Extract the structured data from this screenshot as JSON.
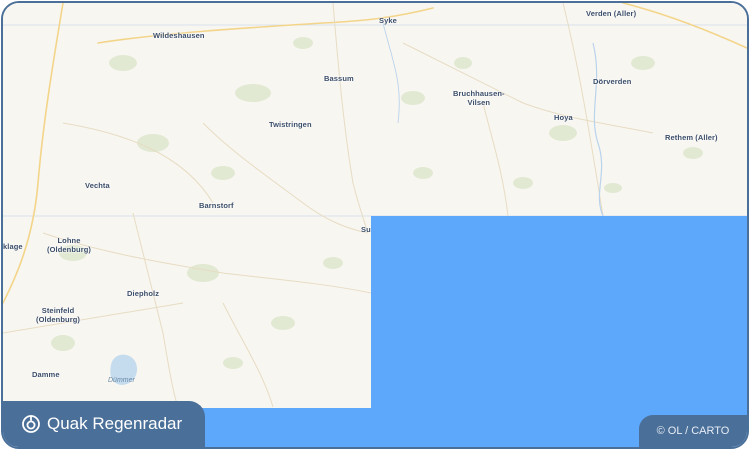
{
  "brand": {
    "name": "Quak Regenradar",
    "icon": "radar-icon"
  },
  "attribution": {
    "text": "© OL / CARTO"
  },
  "colors": {
    "frame": "#4a6f98",
    "radar_overlay": "#5ea8fb",
    "map_background": "#f8f6f1"
  },
  "map": {
    "places": {
      "wildeshausen": "Wildeshausen",
      "syke": "Syke",
      "verden": "Verden (Aller)",
      "bassum": "Bassum",
      "bruchhausen_1": "Bruchhausen-",
      "bruchhausen_2": "Vilsen",
      "doerverden": "Dörverden",
      "twistringen": "Twistringen",
      "hoya": "Hoya",
      "rethem": "Rethem (Aller)",
      "vechta": "Vechta",
      "barnstorf": "Barnstorf",
      "lohne_1": "Lohne",
      "lohne_2": "(Oldenburg)",
      "klage": "klage",
      "sulingen_partial": "Su",
      "diepholz": "Diepholz",
      "steinfeld_1": "Steinfeld",
      "steinfeld_2": "(Oldenburg)",
      "damme": "Damme"
    },
    "lake": "Dümmer"
  }
}
